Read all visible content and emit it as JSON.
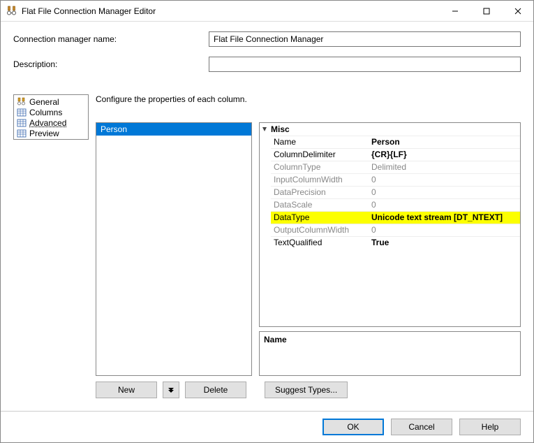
{
  "window": {
    "title": "Flat File Connection Manager Editor"
  },
  "fields": {
    "name_label": "Connection manager name:",
    "name_value": "Flat File Connection Manager",
    "desc_label": "Description:",
    "desc_value": ""
  },
  "nav": {
    "items": [
      {
        "label": "General"
      },
      {
        "label": "Columns"
      },
      {
        "label": "Advanced"
      },
      {
        "label": "Preview"
      }
    ],
    "selected_index": 2
  },
  "instruction": "Configure the properties of each column.",
  "column_list": {
    "header": "Person"
  },
  "props": {
    "category": "Misc",
    "rows": [
      {
        "label": "Name",
        "value": "Person",
        "bold": true
      },
      {
        "label": "ColumnDelimiter",
        "value": "{CR}{LF}",
        "bold": true
      },
      {
        "label": "ColumnType",
        "value": "Delimited",
        "disabled": true
      },
      {
        "label": "InputColumnWidth",
        "value": "0",
        "disabled": true
      },
      {
        "label": "DataPrecision",
        "value": "0",
        "disabled": true
      },
      {
        "label": "DataScale",
        "value": "0",
        "disabled": true
      },
      {
        "label": "DataType",
        "value": "Unicode text stream [DT_NTEXT]",
        "bold": true,
        "highlight": true
      },
      {
        "label": "OutputColumnWidth",
        "value": "0",
        "disabled": true
      },
      {
        "label": "TextQualified",
        "value": "True",
        "bold": true
      }
    ]
  },
  "desc": {
    "title": "Name",
    "body": ""
  },
  "buttons": {
    "new": "New",
    "delete": "Delete",
    "suggest": "Suggest Types...",
    "ok": "OK",
    "cancel": "Cancel",
    "help": "Help"
  }
}
